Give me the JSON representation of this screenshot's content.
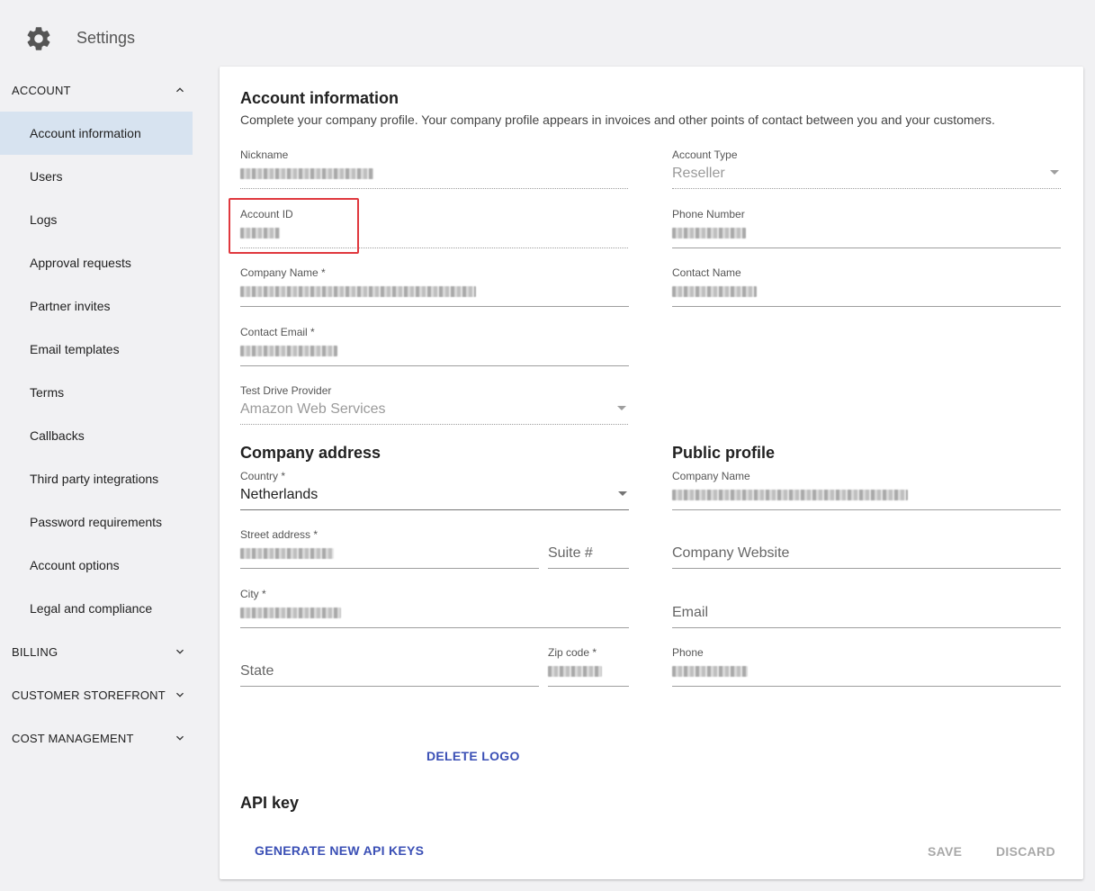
{
  "app": {
    "title": "Settings"
  },
  "sidebar": {
    "sections": [
      {
        "label": "ACCOUNT",
        "expanded": true
      },
      {
        "label": "BILLING",
        "expanded": false
      },
      {
        "label": "CUSTOMER STOREFRONT",
        "expanded": false
      },
      {
        "label": "COST MANAGEMENT",
        "expanded": false
      }
    ],
    "account_items": [
      "Account information",
      "Users",
      "Logs",
      "Approval requests",
      "Partner invites",
      "Email templates",
      "Terms",
      "Callbacks",
      "Third party integrations",
      "Password requirements",
      "Account options",
      "Legal and compliance"
    ],
    "active_item": "Account information"
  },
  "main": {
    "title": "Account information",
    "description": "Complete your company profile. Your company profile appears in invoices and other points of contact between you and your customers.",
    "fields": {
      "nickname": {
        "label": "Nickname"
      },
      "account_type": {
        "label": "Account Type",
        "value": "Reseller"
      },
      "account_id": {
        "label": "Account ID"
      },
      "phone_number": {
        "label": "Phone Number"
      },
      "company_name": {
        "label": "Company Name *"
      },
      "contact_name": {
        "label": "Contact Name"
      },
      "contact_email": {
        "label": "Contact Email *"
      },
      "test_drive_provider": {
        "label": "Test Drive Provider",
        "value": "Amazon Web Services"
      }
    },
    "company_address": {
      "title": "Company address",
      "country": {
        "label": "Country *",
        "value": "Netherlands"
      },
      "street": {
        "label": "Street address *"
      },
      "suite": {
        "placeholder": "Suite #"
      },
      "city": {
        "label": "City *"
      },
      "state": {
        "placeholder": "State"
      },
      "zip": {
        "label": "Zip code *"
      }
    },
    "public_profile": {
      "title": "Public profile",
      "company_name": {
        "label": "Company Name"
      },
      "website": {
        "placeholder": "Company Website"
      },
      "email": {
        "placeholder": "Email"
      },
      "phone": {
        "label": "Phone"
      }
    },
    "delete_logo": "DELETE LOGO",
    "api_key": {
      "title": "API key",
      "generate": "GENERATE NEW API KEYS"
    },
    "actions": {
      "save": "SAVE",
      "discard": "DISCARD"
    }
  },
  "colors": {
    "accent": "#3a4fb5",
    "active_bg": "#d7e3f0",
    "highlight": "#e0383e"
  },
  "icons": {
    "header": "gear-icon",
    "expanded": "chevron-up-icon",
    "collapsed": "chevron-down-icon",
    "select": "dropdown-caret-icon"
  }
}
